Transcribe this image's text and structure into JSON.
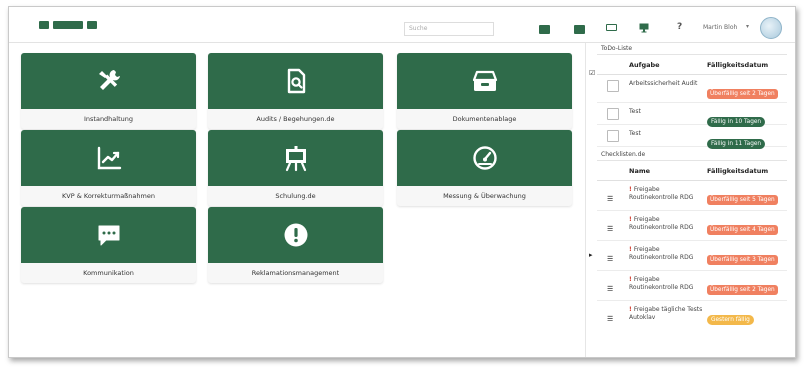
{
  "header": {
    "left_text": "",
    "search_placeholder": "Suche",
    "help": "?",
    "user": "Martin Bloh",
    "caret": "▾"
  },
  "tiles": [
    {
      "label": "Instandhaltung",
      "icon": "tools-icon"
    },
    {
      "label": "Audits / Begehungen.de",
      "icon": "document-search-icon"
    },
    {
      "label": "Dokumentenablage",
      "icon": "archive-box-icon"
    },
    {
      "label": "KVP & Korrekturmaßnahmen",
      "icon": "chart-trend-icon"
    },
    {
      "label": "Schulung.de",
      "icon": "presentation-board-icon"
    },
    {
      "label": "Messung & Überwachung",
      "icon": "gauge-icon"
    },
    {
      "label": "Kommunikation",
      "icon": "chat-bubble-icon"
    },
    {
      "label": "Reklamationsmanagement",
      "icon": "exclamation-circle-icon"
    }
  ],
  "todo": {
    "title": "ToDo-Liste",
    "col_task": "Aufgabe",
    "col_due": "Fälligkeitsdatum",
    "rows": [
      {
        "task": "Arbeitssicherheit Audit",
        "due": "Überfällig seit 2 Tagen",
        "status": "overdue"
      },
      {
        "task": "Test",
        "due": "Fällig in 10 Tagen",
        "status": "due"
      },
      {
        "task": "Test",
        "due": "Fällig in 11 Tagen",
        "status": "due"
      }
    ]
  },
  "checklists": {
    "title": "Checklisten.de",
    "col_name": "Name",
    "col_due": "Fälligkeitsdatum",
    "rows": [
      {
        "name": "Freigabe Routinekontrolle RDG",
        "due": "Überfällig seit 5 Tagen",
        "status": "overdue"
      },
      {
        "name": "Freigabe Routinekontrolle RDG",
        "due": "Überfällig seit 4 Tagen",
        "status": "overdue"
      },
      {
        "name": "Freigabe Routinekontrolle RDG",
        "due": "Überfällig seit 3 Tagen",
        "status": "overdue"
      },
      {
        "name": "Freigabe Routinekontrolle RDG",
        "due": "Überfällig seit 2 Tagen",
        "status": "overdue"
      },
      {
        "name": "Freigabe tägliche Tests Autoklav",
        "due": "Gestern fällig",
        "status": "yesterday"
      }
    ]
  },
  "colors": {
    "brand_green": "#2f6b4a",
    "overdue": "#f08060",
    "yesterday": "#f3b84a"
  }
}
